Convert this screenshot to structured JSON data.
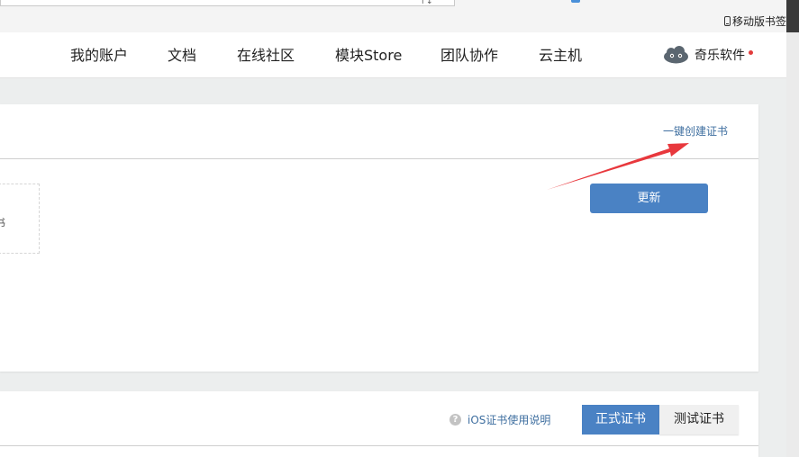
{
  "browser": {
    "address_btn_label": "↑↓",
    "mobile_bookmarks_label": "移动版书签"
  },
  "nav": {
    "items": [
      "我的账户",
      "文档",
      "在线社区",
      "模块Store",
      "团队协作",
      "云主机"
    ],
    "user_name": "奇乐软件"
  },
  "panel1": {
    "one_click_label": "一键创建证书",
    "box_partial_text": "书",
    "update_label": "更新"
  },
  "panel2": {
    "help_label": "iOS证书使用说明",
    "tab_formal_label": "正式证书",
    "tab_test_label": "测试证书"
  },
  "colors": {
    "accent": "#4a82c4",
    "link": "#3f6fa0",
    "annotation_arrow": "#e8383d",
    "notification_dot": "#e23c3c"
  },
  "icons": {
    "avatar": "cloud-robot-icon",
    "help": "question-circle-icon",
    "bookmark": "phone-icon"
  }
}
